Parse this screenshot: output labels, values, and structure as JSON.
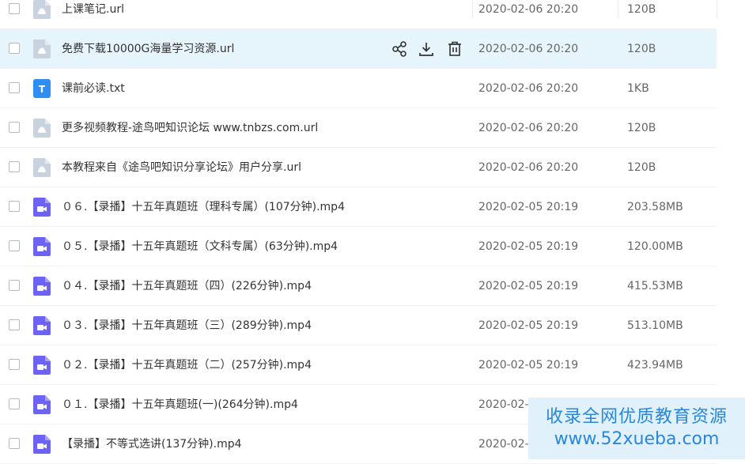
{
  "files": [
    {
      "name": "上课笔记.url",
      "date": "2020-02-06 20:20",
      "size": "120B",
      "type": "url"
    },
    {
      "name": "免费下载10000G海量学习资源.url",
      "date": "2020-02-06 20:20",
      "size": "120B",
      "type": "url",
      "hover": true
    },
    {
      "name": "课前必读.txt",
      "date": "2020-02-06 20:20",
      "size": "1KB",
      "type": "txt"
    },
    {
      "name": "更多视频教程-途鸟吧知识论坛 www.tnbzs.com.url",
      "date": "2020-02-06 20:20",
      "size": "120B",
      "type": "url"
    },
    {
      "name": "本教程来自《途鸟吧知识分享论坛》用户分享.url",
      "date": "2020-02-06 20:20",
      "size": "120B",
      "type": "url"
    },
    {
      "name": "０６.【录播】十五年真题班（理科专属）(107分钟).mp4",
      "date": "2020-02-05 20:19",
      "size": "203.58MB",
      "type": "video"
    },
    {
      "name": "０５.【录播】十五年真题班（文科专属）(63分钟).mp4",
      "date": "2020-02-05 20:19",
      "size": "120.00MB",
      "type": "video"
    },
    {
      "name": "０４.【录播】十五年真题班（四）(226分钟).mp4",
      "date": "2020-02-05 20:19",
      "size": "415.53MB",
      "type": "video"
    },
    {
      "name": "０３.【录播】十五年真题班（三）(289分钟).mp4",
      "date": "2020-02-05 20:19",
      "size": "513.10MB",
      "type": "video"
    },
    {
      "name": "０２.【录播】十五年真题班（二）(257分钟).mp4",
      "date": "2020-02-05 20:19",
      "size": "423.94MB",
      "type": "video"
    },
    {
      "name": "０１.【录播】十五年真题班(一)(264分钟).mp4",
      "date": "2020-02-",
      "size": "",
      "type": "video"
    },
    {
      "name": "【录播】不等式选讲(137分钟).mp4",
      "date": "2020-02-",
      "size": "",
      "type": "video"
    }
  ],
  "row_actions": {
    "share_icon": "share-icon",
    "download_icon": "download-icon",
    "delete_icon": "trash-icon"
  },
  "watermark": {
    "line1": "收录全网优质教育资源",
    "line2": "www.52xueba.com"
  },
  "colors": {
    "hover_row": "#e6f4fb",
    "video_icon": "#6c63f5",
    "txt_icon": "#2f8ef4",
    "url_icon": "#c9d3df",
    "watermark_text": "#2a86d8"
  }
}
